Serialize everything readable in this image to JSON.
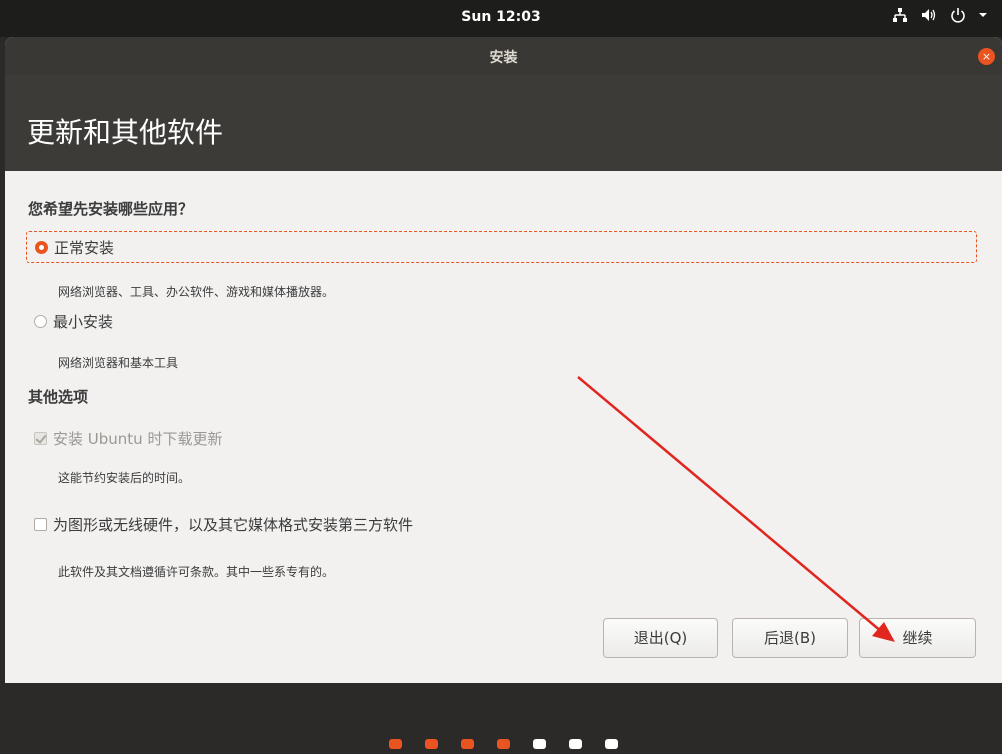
{
  "topbar": {
    "clock": "Sun 12:03"
  },
  "window": {
    "title": "安装",
    "close_symbol": "×"
  },
  "header": {
    "title": "更新和其他软件"
  },
  "question": "您希望先安装哪些应用？",
  "options": {
    "normal": {
      "label": "正常安装",
      "desc": "网络浏览器、工具、办公软件、游戏和媒体播放器。",
      "selected": true
    },
    "minimal": {
      "label": "最小安装",
      "desc": "网络浏览器和基本工具",
      "selected": false
    }
  },
  "other": {
    "title": "其他选项",
    "download_updates": {
      "label": "安装 Ubuntu 时下载更新",
      "desc": "这能节约安装后的时间。",
      "checked": true,
      "disabled": true
    },
    "third_party": {
      "label": "为图形或无线硬件，以及其它媒体格式安装第三方软件",
      "desc": "此软件及其文档遵循许可条款。其中一些系专有的。",
      "checked": false
    }
  },
  "buttons": {
    "quit": "退出(Q)",
    "back": "后退(B)",
    "continue": "继续"
  },
  "progress": {
    "total_steps": 7,
    "completed_steps": 4
  },
  "colors": {
    "accent": "#e95420",
    "annotation": "#e0261f"
  }
}
